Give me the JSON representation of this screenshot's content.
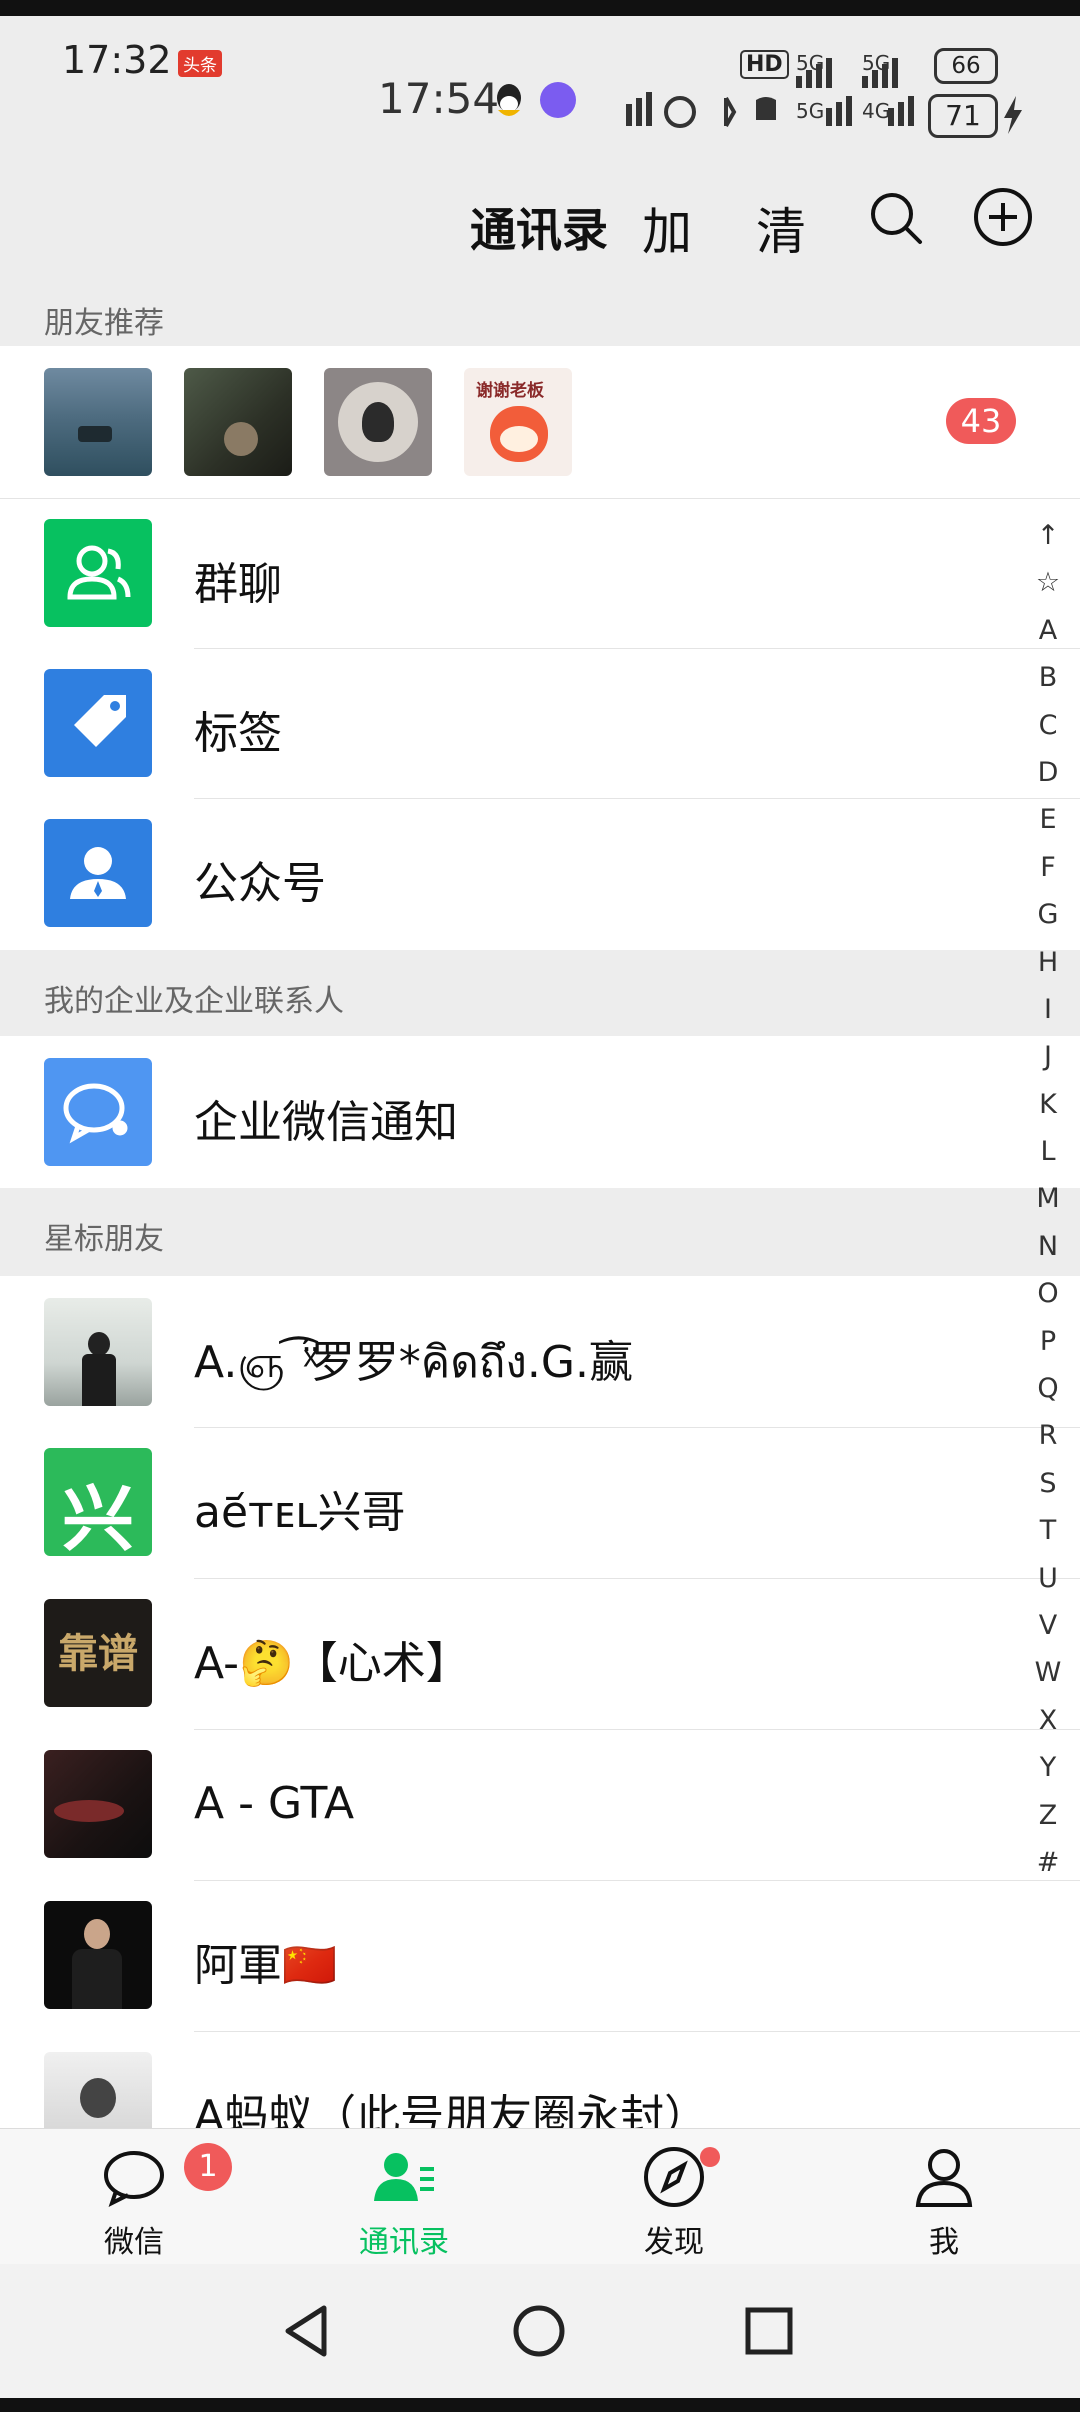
{
  "status_bar": {
    "time_outer": "17:32",
    "outer_app_badge": "头条",
    "time_inner": "17:54",
    "battery_top": "66",
    "battery_bottom": "71",
    "hd_label": "HD"
  },
  "header": {
    "title": "通讯录",
    "extra1": "加",
    "extra2": "清"
  },
  "sections": {
    "recommend": "朋友推荐",
    "enterprise": "我的企业及企业联系人",
    "starred": "星标朋友"
  },
  "recommend": {
    "badge": "43",
    "avatar4_text": "谢谢老板"
  },
  "functions": [
    {
      "label": "群聊",
      "color": "#07c160"
    },
    {
      "label": "标签",
      "color": "#2f7fe0"
    },
    {
      "label": "公众号",
      "color": "#2f7fe0"
    }
  ],
  "enterprise_items": [
    {
      "label": "企业微信通知"
    }
  ],
  "contacts": [
    {
      "name": "A.ஞ ͡ ̈́ͯ罗罗*คิดถึง.G.赢",
      "avatar_text": ""
    },
    {
      "name": "ae᷄ᴛᴇʟ兴哥",
      "avatar_text": "兴"
    },
    {
      "name": "A-🤔【心术】",
      "avatar_text": "靠谱"
    },
    {
      "name": "A - GTA",
      "avatar_text": ""
    },
    {
      "name": "阿軍🇨🇳",
      "avatar_text": ""
    },
    {
      "name": "A蚂蚁（此号朋友圈永封）",
      "avatar_text": ""
    }
  ],
  "index_letters": [
    "↑",
    "☆",
    "A",
    "B",
    "C",
    "D",
    "E",
    "F",
    "G",
    "H",
    "I",
    "J",
    "K",
    "L",
    "M",
    "N",
    "O",
    "P",
    "Q",
    "R",
    "S",
    "T",
    "U",
    "V",
    "W",
    "X",
    "Y",
    "Z",
    "#"
  ],
  "tabs": [
    {
      "label": "微信",
      "badge": "1"
    },
    {
      "label": "通讯录"
    },
    {
      "label": "发现"
    },
    {
      "label": "我"
    }
  ],
  "colors": {
    "accent": "#07c160",
    "badge": "#f05a5a",
    "blue": "#2f7fe0"
  }
}
